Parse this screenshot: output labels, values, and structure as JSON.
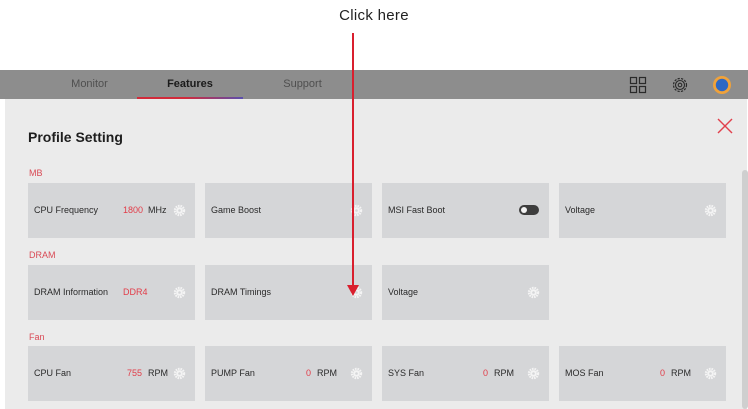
{
  "annotation": {
    "text": "Click here"
  },
  "tabs": [
    {
      "label": "Monitor",
      "active": false
    },
    {
      "label": "Features",
      "active": true
    },
    {
      "label": "Support",
      "active": false
    }
  ],
  "toolbar_icons": [
    "grid-icon",
    "gear-icon",
    "avatar"
  ],
  "panel": {
    "title": "Profile Setting",
    "close_icon": "close-icon"
  },
  "sections": {
    "mb": {
      "label": "MB",
      "cards": [
        {
          "label": "CPU Frequency",
          "value": "1800",
          "unit": "MHz",
          "control": "gear"
        },
        {
          "label": "Game Boost",
          "value": "",
          "unit": "",
          "control": "gear"
        },
        {
          "label": "MSI Fast Boot",
          "value": "",
          "unit": "",
          "control": "toggle",
          "toggle_state": "off"
        },
        {
          "label": "Voltage",
          "value": "",
          "unit": "",
          "control": "gear"
        }
      ]
    },
    "dram": {
      "label": "DRAM",
      "cards": [
        {
          "label": "DRAM Information",
          "value": "DDR4",
          "unit": "",
          "control": "gear"
        },
        {
          "label": "DRAM Timings",
          "value": "",
          "unit": "",
          "control": "gear"
        },
        {
          "label": "Voltage",
          "value": "",
          "unit": "",
          "control": "gear"
        }
      ]
    },
    "fan": {
      "label": "Fan",
      "cards": [
        {
          "label": "CPU Fan",
          "value": "755",
          "unit": "RPM",
          "control": "gear"
        },
        {
          "label": "PUMP Fan",
          "value": "0",
          "unit": "RPM",
          "control": "gear"
        },
        {
          "label": "SYS Fan",
          "value": "0",
          "unit": "RPM",
          "control": "gear"
        },
        {
          "label": "MOS Fan",
          "value": "0",
          "unit": "RPM",
          "control": "gear"
        }
      ]
    }
  },
  "colors": {
    "accent_red": "#e23c48",
    "section_label": "#d94a55",
    "card_bg": "#d5d6d8",
    "topbar_bg": "#8d8d8d",
    "panel_bg": "#ebebeb"
  }
}
